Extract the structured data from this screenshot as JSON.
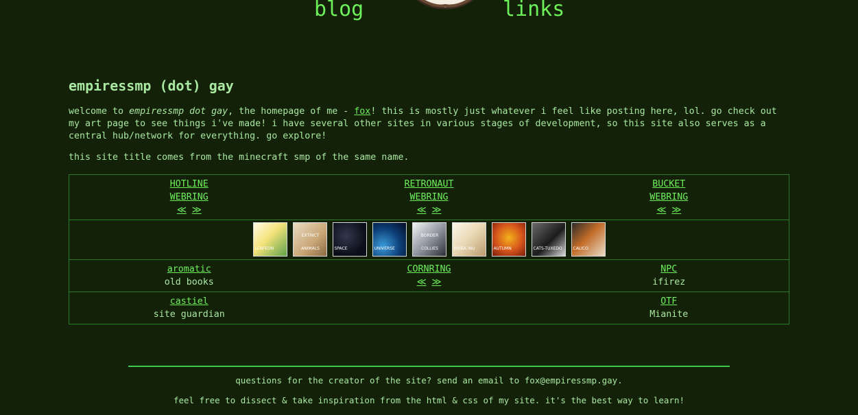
{
  "nav": {
    "blog_label": "blog",
    "links_label": "links"
  },
  "page": {
    "title": "empiressmp (dot) gay",
    "intro_prefix": "welcome to ",
    "intro_site_name": "empiressmp dot gay",
    "intro_mid": ", the homepage of me - ",
    "intro_link": "fox",
    "intro_suffix": "! this is mostly just whatever i feel like posting here, lol. go check out my art page to see things i've made! i have several other sites in various stages of development, so this site also serves as a central hub/network for everything. go explore!",
    "title_note": "this site title comes from the minecraft smp of the same name."
  },
  "webrings": {
    "row1": [
      {
        "name_line1": "HOTLINE",
        "name_line2": "WEBRING",
        "prev": "≪",
        "next": "≫"
      },
      {
        "name_line1": "RETRONAUT",
        "name_line2": "WEBRING",
        "prev": "≪",
        "next": "≫"
      },
      {
        "name_line1": "BUCKET",
        "name_line2": "WEBRING",
        "prev": "≪",
        "next": "≫"
      }
    ],
    "stamps": [
      "LEAFEON",
      "EXTINCT ANIMALS",
      "SPACE",
      "UNIVERSE",
      "BORDER COLLIES",
      "SHIBA INU",
      "AUTUMN",
      "CATS-TUXEDO",
      "CALICO"
    ],
    "row3": [
      {
        "link": "aromatic",
        "sub": "old books"
      },
      {
        "link": "CORNRING",
        "prev": "≪",
        "next": "≫"
      },
      {
        "link": "NPC",
        "sub": "ifirez"
      }
    ],
    "row4": [
      {
        "link": "castiel",
        "sub": "site guardian"
      },
      {
        "link": "OTF",
        "sub": "Mianite"
      }
    ]
  },
  "footer": {
    "contact": "questions for the creator of the site? send an email to fox@empiressmp.gay.",
    "inspiration": "feel free to dissect & take inspiration from the html & css of my site. it's the best way to learn!"
  },
  "colors": {
    "background": "#132109",
    "link": "#6ef05a",
    "text": "#a9e8a0",
    "border": "#2c7a2a"
  }
}
